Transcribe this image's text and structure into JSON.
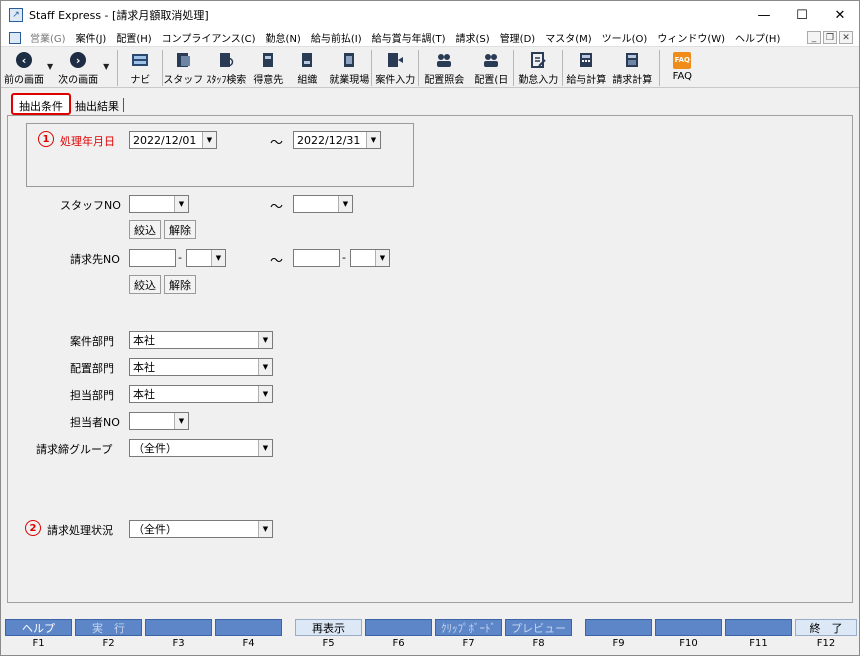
{
  "window": {
    "title": "Staff Express - [請求月額取消処理]",
    "min": "—",
    "max": "☐",
    "close": "✕"
  },
  "menubar": {
    "items": [
      "営業(G)",
      "案件(J)",
      "配置(H)",
      "コンプライアンス(C)",
      "勤怠(N)",
      "給与前払(I)",
      "給与賞与年調(T)",
      "請求(S)",
      "管理(D)",
      "マスタ(M)",
      "ツール(O)",
      "ウィンドウ(W)",
      "ヘルプ(H)"
    ],
    "mdi_min": "_",
    "mdi_restore": "❐",
    "mdi_close": "✕"
  },
  "toolbar": {
    "prev": "前の画面",
    "next": "次の画面",
    "navi": "ナビ",
    "staff": "スタッフ",
    "staff_search": "ｽﾀｯﾌ検索",
    "client": "得意先",
    "org": "組織",
    "worksite": "就業現場",
    "job_entry": "案件入力",
    "assign_inquiry": "配置照会",
    "assign_day": "配置(日",
    "attendance": "勤怠入力",
    "payroll": "給与計算",
    "billing": "請求計算",
    "faq": "FAQ",
    "faq_glyph": "FAQ"
  },
  "tabs": {
    "conditions": "抽出条件",
    "results": "抽出結果"
  },
  "form": {
    "marker1": "1",
    "date_label": "処理年月日",
    "date_from": "2022/12/01",
    "date_to": "2022/12/31",
    "tilde": "～",
    "staff_no_label": "スタッフNO",
    "staff_from": "",
    "staff_to": "",
    "narrow": "絞込",
    "clear": "解除",
    "client_no_label": "請求先NO",
    "client_from_a": "",
    "client_from_b": "",
    "client_to_a": "",
    "client_to_b": "",
    "dash": "-",
    "job_dept_label": "案件部門",
    "job_dept": "本社",
    "assign_dept_label": "配置部門",
    "assign_dept": "本社",
    "owner_dept_label": "担当部門",
    "owner_dept": "本社",
    "owner_no_label": "担当者NO",
    "owner_no": "",
    "bill_group_label": "請求締グループ",
    "bill_group": "（全件）",
    "marker2": "2",
    "status_label": "請求処理状況",
    "status": "（全件）"
  },
  "fkeys": {
    "F1": "ヘルプ",
    "F2": "実　行",
    "F3": "",
    "F4": "",
    "F5": "再表示",
    "F6": "",
    "F7": "ｸﾘｯﾌﾟﾎﾞｰﾄﾞ",
    "F8": "プレビュー",
    "F9": "",
    "F10": "",
    "F11": "",
    "F12": "終　了",
    "keys": [
      "F1",
      "F2",
      "F3",
      "F4",
      "F5",
      "F6",
      "F7",
      "F8",
      "F9",
      "F10",
      "F11",
      "F12"
    ]
  }
}
